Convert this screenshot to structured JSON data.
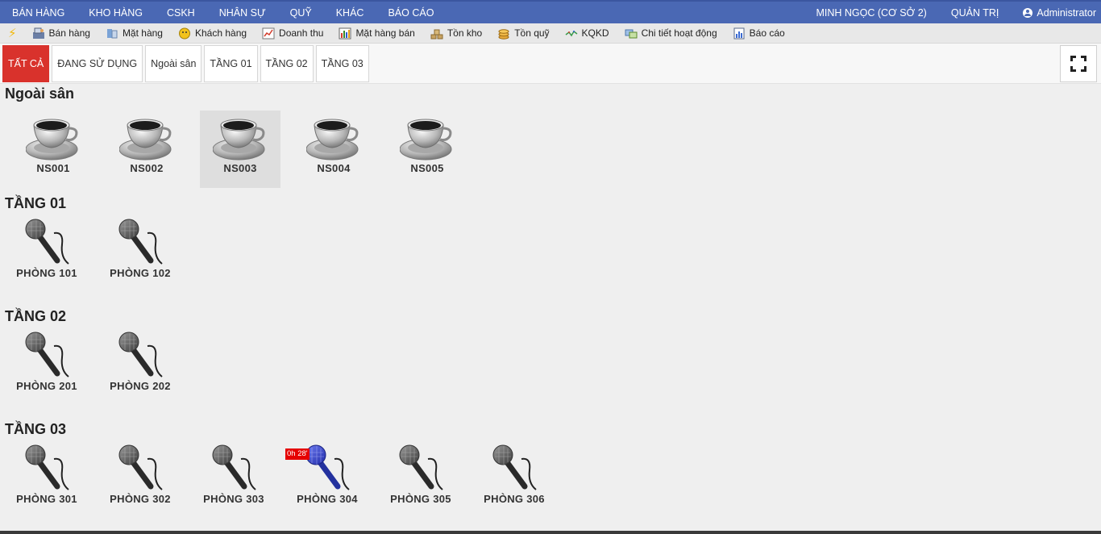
{
  "topnav": {
    "left": [
      "BÁN HÀNG",
      "KHO HÀNG",
      "CSKH",
      "NHÂN SỰ",
      "QUỸ",
      "KHÁC",
      "BÁO CÁO"
    ],
    "store": "MINH NGỌC (CƠ SỞ 2)",
    "admin": "QUẢN TRỊ",
    "user": "Administrator"
  },
  "toolbar": [
    {
      "label": "Bán hàng",
      "icon": "cashier-icon"
    },
    {
      "label": "Mặt hàng",
      "icon": "products-icon"
    },
    {
      "label": "Khách hàng",
      "icon": "customer-icon"
    },
    {
      "label": "Doanh thu",
      "icon": "revenue-icon"
    },
    {
      "label": "Mặt hàng bán",
      "icon": "bar-chart-icon"
    },
    {
      "label": "Tồn kho",
      "icon": "stock-icon"
    },
    {
      "label": "Tồn quỹ",
      "icon": "coins-icon"
    },
    {
      "label": "KQKD",
      "icon": "trend-icon"
    },
    {
      "label": "Chi tiết hoạt động",
      "icon": "activity-icon"
    },
    {
      "label": "Báo cáo",
      "icon": "report-icon"
    }
  ],
  "tabs": [
    "TẤT CẢ",
    "ĐANG SỬ DỤNG",
    "Ngoài sân",
    "TẦNG 01",
    "TẦNG 02",
    "TẦNG 03"
  ],
  "active_tab": "TẤT CẢ",
  "sections": {
    "outdoor": {
      "title": "Ngoài sân",
      "tables": [
        "NS001",
        "NS002",
        "NS003",
        "NS004",
        "NS005"
      ],
      "selected": "NS003"
    },
    "floor1": {
      "title": "TẦNG 01",
      "rooms": [
        "PHÒNG 101",
        "PHÒNG 102"
      ]
    },
    "floor2": {
      "title": "TẦNG 02",
      "rooms": [
        "PHÒNG 201",
        "PHÒNG 202"
      ]
    },
    "floor3": {
      "title": "TẦNG 03",
      "rooms": [
        "PHÒNG 301",
        "PHÒNG 302",
        "PHÒNG 303",
        "PHÒNG 304",
        "PHÒNG 305",
        "PHÒNG 306"
      ],
      "occupied": {
        "room": "PHÒNG 304",
        "timer": "0h 28'"
      }
    }
  },
  "colors": {
    "nav": "#4a68b4",
    "active_tab": "#d9322c",
    "occupied_mic": "#2f40c9",
    "idle_mic": "#555555",
    "timer_badge": "#e50000"
  }
}
